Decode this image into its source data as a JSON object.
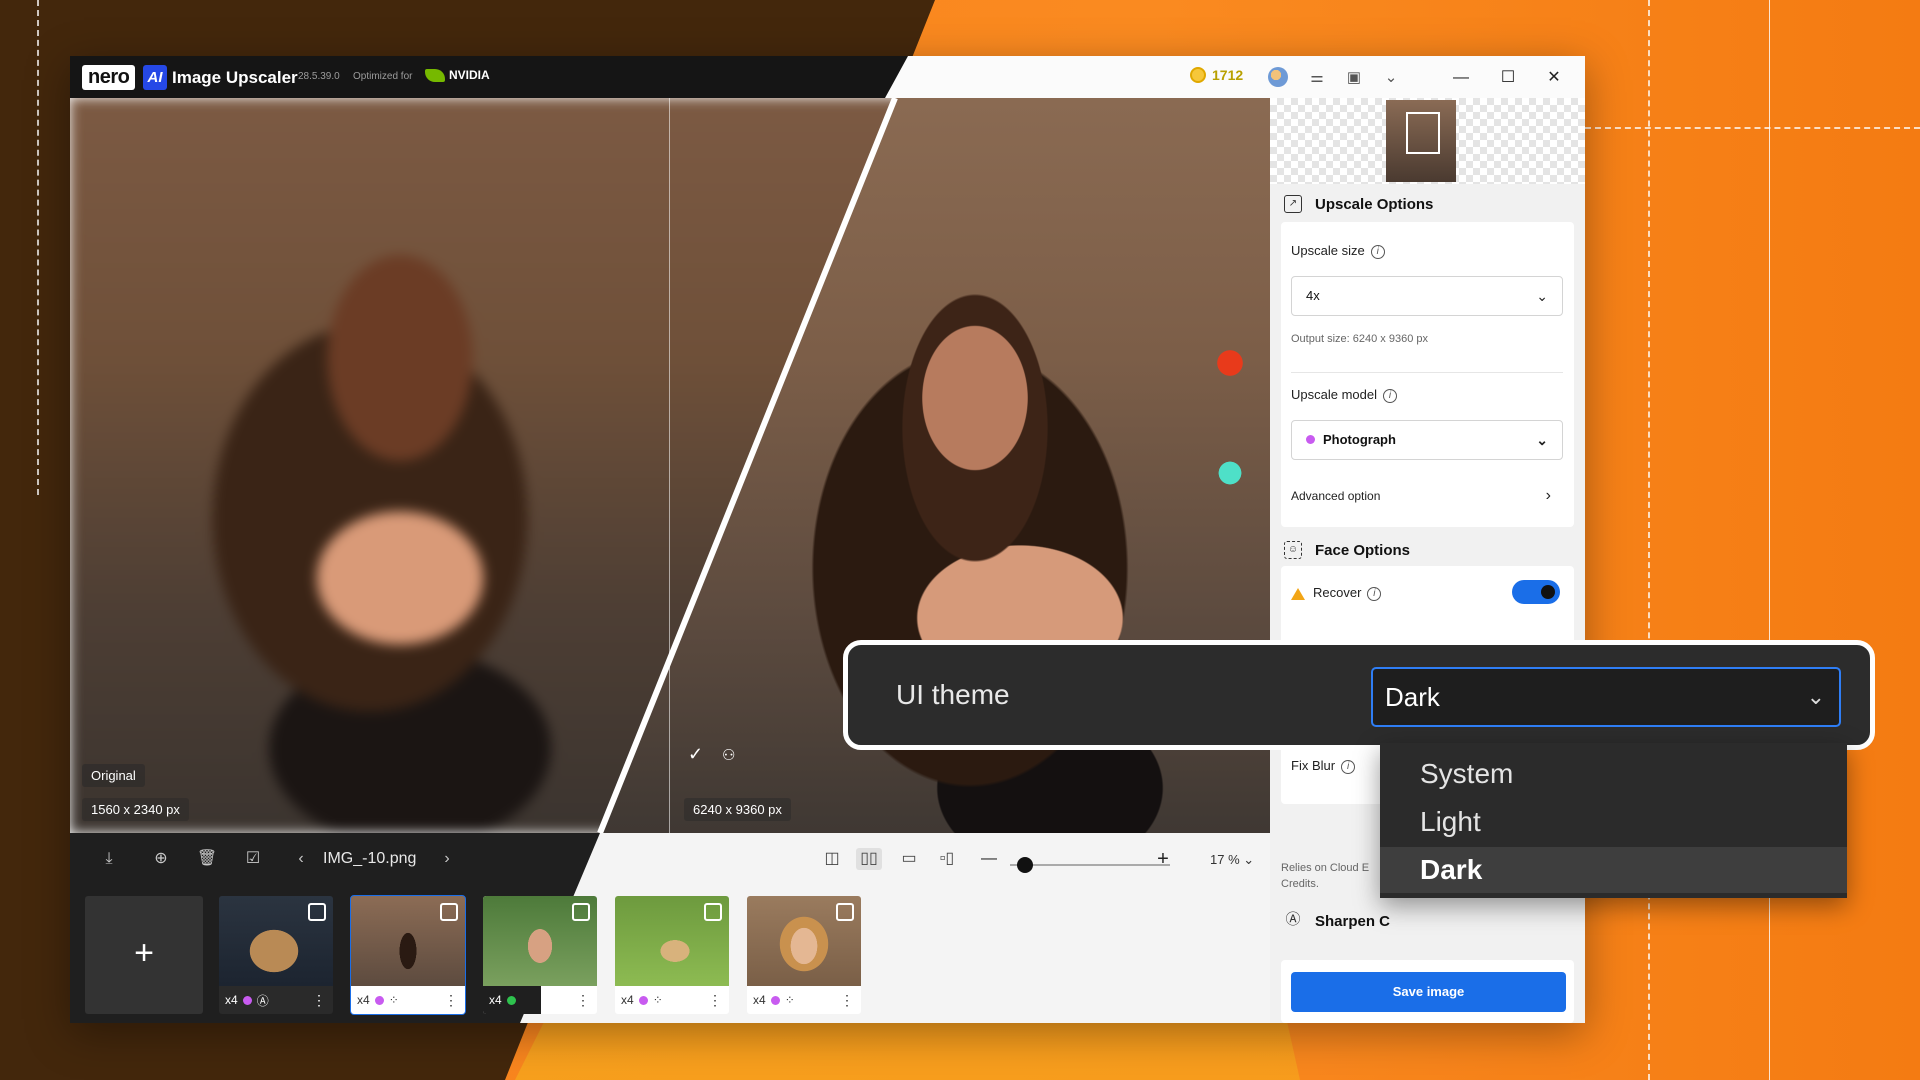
{
  "app": {
    "brand": "nero",
    "ai_badge": "AI",
    "title": "Image Upscaler",
    "version": "28.5.39.0",
    "optimized_for": "Optimized for",
    "partner": "NVIDIA"
  },
  "titlebar": {
    "credits": "1712"
  },
  "preview": {
    "original_label": "Original",
    "original_size": "1560 x 2340 px",
    "result_size": "6240 x 9360 px"
  },
  "toolbar": {
    "filename": "IMG_-10.png",
    "zoom": "17 %"
  },
  "thumbnails": [
    {
      "scale": "x4",
      "selected": false
    },
    {
      "scale": "x4",
      "selected": true
    },
    {
      "scale": "x4",
      "selected": false
    },
    {
      "scale": "x4",
      "selected": false
    },
    {
      "scale": "x4",
      "selected": false
    }
  ],
  "panel": {
    "upscale_options_title": "Upscale Options",
    "upscale_size_label": "Upscale size",
    "upscale_size_value": "4x",
    "output_size": "Output size: 6240 x 9360 px",
    "upscale_model_label": "Upscale model",
    "upscale_model_value": "Photograph",
    "advanced_option": "Advanced option",
    "face_options_title": "Face Options",
    "recover_label": "Recover",
    "recover_on": true,
    "fix_blur_label": "Fix Blur",
    "cloud_note_1": "Relies on Cloud E",
    "cloud_note_2": "Credits.",
    "sharpen_label": "Sharpen C",
    "save_button": "Save image"
  },
  "theme": {
    "label": "UI theme",
    "value": "Dark",
    "options": [
      "System",
      "Light",
      "Dark"
    ]
  },
  "colors": {
    "accent": "#1a6ee8",
    "orange": "#f9821c",
    "dark_brown": "#43270c",
    "model_dot": "#c85bf0",
    "warning": "#f2a516"
  }
}
